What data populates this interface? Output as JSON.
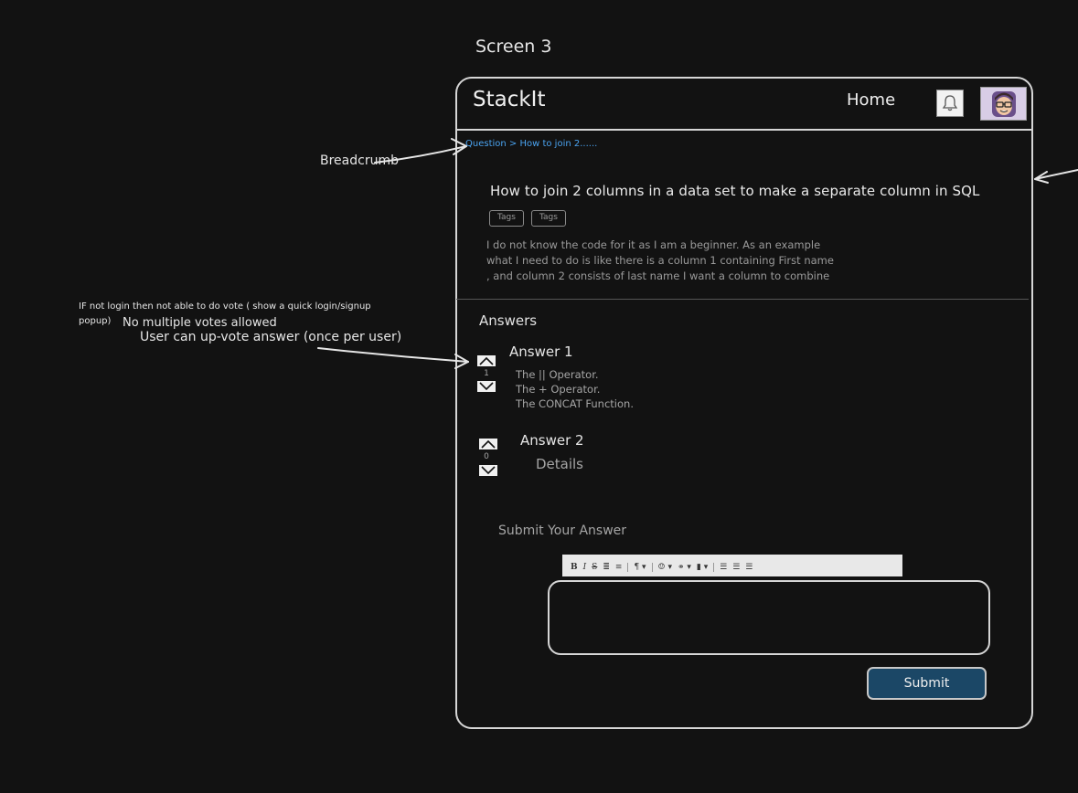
{
  "screen_label": "Screen 3",
  "header": {
    "logo": "StackIt",
    "home_label": "Home",
    "notification_icon": "bell-icon",
    "avatar_icon": "user-avatar-icon"
  },
  "breadcrumb": "Question > How to join 2......",
  "question": {
    "title": "How to join 2 columns in a data set to make a separate column in SQL",
    "tags": [
      "Tags",
      "Tags"
    ],
    "description_lines": [
      "I do not know the code for it as I am a beginner. As an example",
      "what I need to do is like there is a column 1 containing First name",
      ", and column 2 consists of last name I want a column to combine"
    ]
  },
  "answers": {
    "heading": "Answers",
    "items": [
      {
        "title": "Answer 1",
        "votes": "1",
        "lines": [
          "The || Operator.",
          "The + Operator.",
          "The CONCAT Function."
        ]
      },
      {
        "title": "Answer 2",
        "votes": "0",
        "lines": [
          "Details"
        ]
      }
    ]
  },
  "submit_section": {
    "heading": "Submit Your Answer",
    "toolbar": [
      "B",
      "I",
      "S",
      "ordered-list",
      "bullet-list",
      "paragraph",
      "emoji",
      "link",
      "image",
      "align-left",
      "align-center",
      "align-right"
    ],
    "submit_label": "Submit"
  },
  "annotations": {
    "breadcrumb": "Breadcrumb",
    "login_line1": "IF not login then not able to do vote ( show a quick login/signup",
    "login_line2": "popup)",
    "login_line3": "No multiple votes allowed",
    "upvote": "User can up-vote answer (once per user)"
  }
}
